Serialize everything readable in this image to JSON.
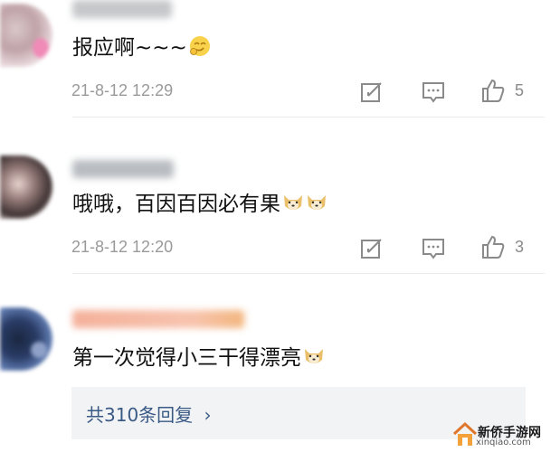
{
  "comments": [
    {
      "text": "报应啊~~~",
      "emoji": "smirk-face-emoji",
      "timestamp": "21-8-12 12:29",
      "likes": "5"
    },
    {
      "text": "哦哦，百因百因必有果",
      "emoji": "doge-emoji",
      "timestamp": "21-8-12 12:20",
      "likes": "3"
    },
    {
      "text": "第一次觉得小三干得漂亮",
      "emoji": "doge-emoji"
    }
  ],
  "replies": {
    "label": "共310条回复",
    "chevron": "›"
  },
  "watermark": {
    "title": "新侨手游网",
    "subtitle": "xinqiao.com"
  },
  "colors": {
    "text": "#111111",
    "meta": "#9a9a9a",
    "link": "#3a5a86",
    "reply_bg": "#f2f3f5"
  }
}
